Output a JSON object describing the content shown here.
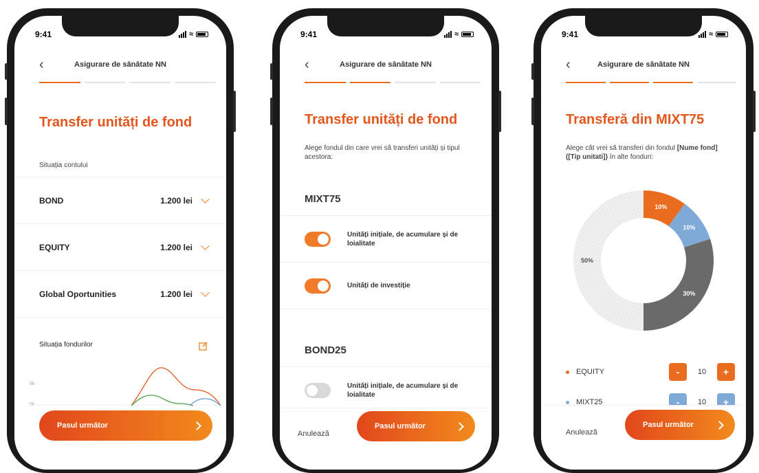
{
  "status": {
    "time": "9:41"
  },
  "nav": {
    "title": "Asigurare de sănătate NN"
  },
  "screen1": {
    "heading": "Transfer unități de fond",
    "account_label": "Situația contului",
    "rows": [
      {
        "name": "BOND",
        "value": "1.200 lei"
      },
      {
        "name": "EQUITY",
        "value": "1.200 lei"
      },
      {
        "name": "Global Oportunities",
        "value": "1.200 lei"
      }
    ],
    "funds_label": "Situația fondurilor",
    "chart_y_ticks": [
      "8k",
      "6k"
    ],
    "cta": "Pasul următor"
  },
  "screen2": {
    "heading": "Transfer unități de fond",
    "subtitle": "Alege fondul din care vrei să transferi unități și tipul acestora:",
    "funds": [
      {
        "name": "MIXT75",
        "options": [
          {
            "label": "Unități inițiale, de acumulare și de loialitate",
            "on": true
          },
          {
            "label": "Unități de investiție",
            "on": true
          }
        ]
      },
      {
        "name": "BOND25",
        "options": [
          {
            "label": "Unități inițiale, de acumulare și de loialitate",
            "on": false
          }
        ]
      }
    ],
    "cancel": "Anulează",
    "cta": "Pasul următor"
  },
  "screen3": {
    "heading": "Transferă din MIXT75",
    "subtitle_pre": "Alege cât vrei să transferi din fondul ",
    "subtitle_bold": "[Nume fond] ([Tip unitati])",
    "subtitle_post": " în alte fonduri:",
    "donut": [
      {
        "label": "10%",
        "value": 10,
        "color": "#ea6c1e"
      },
      {
        "label": "10%",
        "value": 10,
        "color": "#7fa9d6"
      },
      {
        "label": "30%",
        "value": 30,
        "color": "#6a6a6a"
      },
      {
        "label": "50%",
        "value": 50,
        "color": "#e9e9e9"
      }
    ],
    "legend": [
      {
        "name": "EQUITY",
        "value": "10",
        "minus": "-",
        "plus": "+",
        "color": "#ea6c1e"
      },
      {
        "name": "MIXT25",
        "value": "10",
        "minus": "-",
        "plus": "+",
        "color": "#7fa9d6"
      }
    ],
    "cancel": "Anulează",
    "cta": "Pasul următor"
  }
}
